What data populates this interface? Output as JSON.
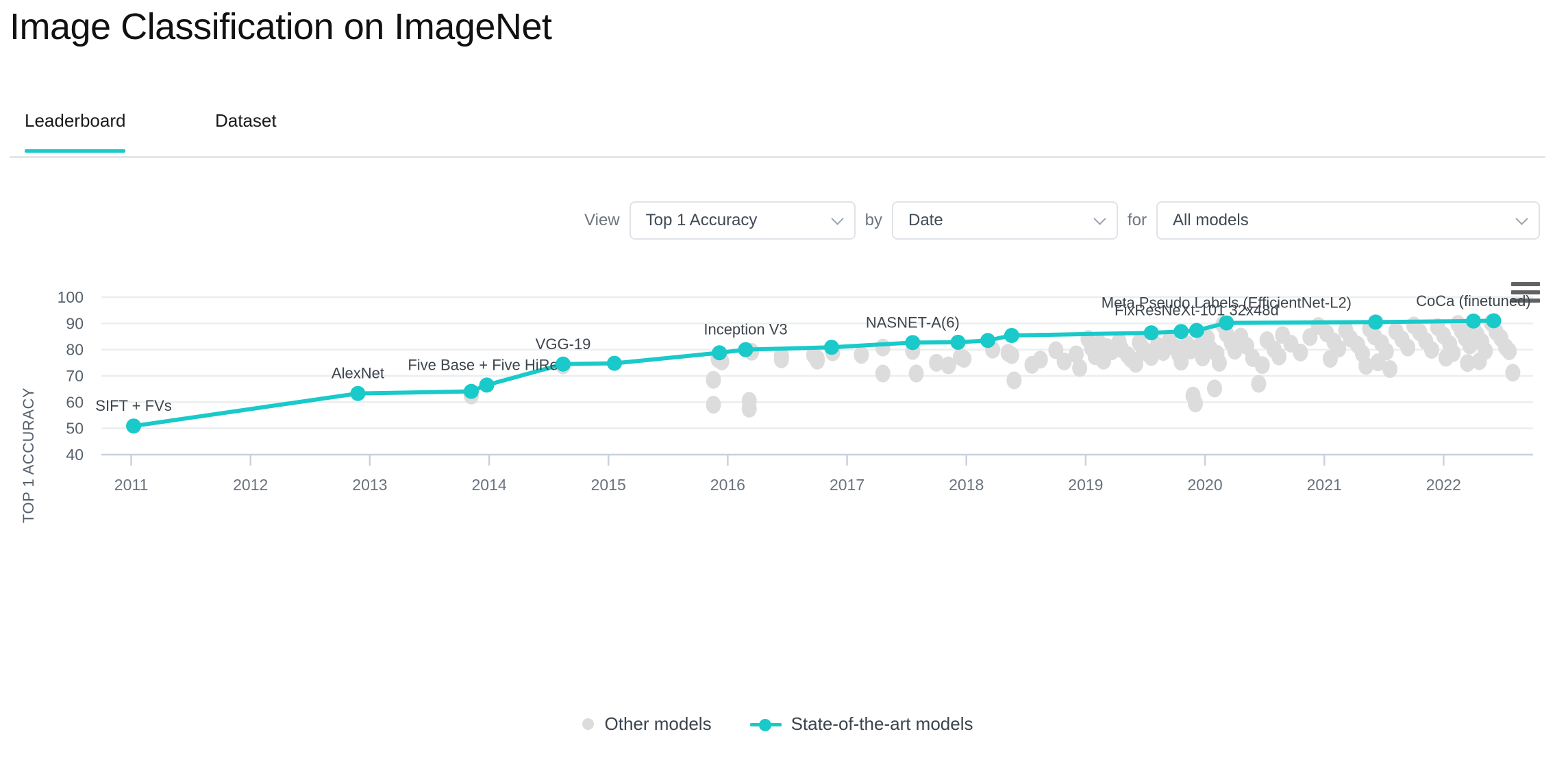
{
  "header": {
    "title": "Image Classification on ImageNet"
  },
  "tabs": [
    {
      "label": "Leaderboard",
      "active": true
    },
    {
      "label": "Dataset",
      "active": false
    }
  ],
  "filters": {
    "view_label": "View",
    "by_label": "by",
    "for_label": "for",
    "metric": "Top 1 Accuracy",
    "axis": "Date",
    "scope": "All models"
  },
  "menu": {
    "icon": "hamburger-menu-icon"
  },
  "legend": {
    "other_models": "Other models",
    "sota_models": "State-of-the-art models"
  },
  "colors": {
    "accent_teal": "#1ac9c9",
    "other_dot_gray": "#dcdcdc",
    "grid": "#ebedee",
    "axis_text": "#55606b"
  },
  "chart_data": {
    "type": "scatter",
    "title": "Image Classification on ImageNet",
    "xlabel": "",
    "ylabel": "TOP 1 ACCURACY",
    "xlim": [
      2010.75,
      2022.75
    ],
    "ylim": [
      40,
      100
    ],
    "yticks": [
      40,
      50,
      60,
      70,
      80,
      90,
      100
    ],
    "xticks": [
      2011,
      2012,
      2013,
      2014,
      2015,
      2016,
      2017,
      2018,
      2019,
      2020,
      2021,
      2022
    ],
    "grid": true,
    "legend_position": "bottom",
    "series": [
      {
        "name": "State-of-the-art models",
        "color": "#1ac9c9",
        "type": "line",
        "points": [
          {
            "x": 2011.02,
            "y": 50.9,
            "label": "SIFT + FVs"
          },
          {
            "x": 2012.9,
            "y": 63.3,
            "label": "AlexNet"
          },
          {
            "x": 2013.85,
            "y": 64.1,
            "label": ""
          },
          {
            "x": 2013.98,
            "y": 66.5,
            "label": "Five Base + Five HiRes"
          },
          {
            "x": 2014.62,
            "y": 74.5,
            "label": "VGG-19"
          },
          {
            "x": 2015.05,
            "y": 74.8,
            "label": ""
          },
          {
            "x": 2015.93,
            "y": 78.8,
            "label": ""
          },
          {
            "x": 2016.15,
            "y": 80.0,
            "label": "Inception V3"
          },
          {
            "x": 2016.87,
            "y": 80.9,
            "label": ""
          },
          {
            "x": 2017.55,
            "y": 82.7,
            "label": "NASNET-A(6)"
          },
          {
            "x": 2017.93,
            "y": 82.8,
            "label": ""
          },
          {
            "x": 2018.18,
            "y": 83.5,
            "label": ""
          },
          {
            "x": 2018.38,
            "y": 85.4,
            "label": ""
          },
          {
            "x": 2019.55,
            "y": 86.4,
            "label": ""
          },
          {
            "x": 2019.8,
            "y": 86.9,
            "label": ""
          },
          {
            "x": 2019.93,
            "y": 87.3,
            "label": "FixResNeXt-101 32x48d"
          },
          {
            "x": 2020.18,
            "y": 90.2,
            "label": "Meta Pseudo Labels (EfficientNet-L2)"
          },
          {
            "x": 2021.43,
            "y": 90.5,
            "label": ""
          },
          {
            "x": 2022.25,
            "y": 90.9,
            "label": "CoCa (finetuned)"
          },
          {
            "x": 2022.42,
            "y": 91.0,
            "label": ""
          }
        ]
      },
      {
        "name": "Other models",
        "color": "#dcdcdc",
        "type": "scatter",
        "points": [
          {
            "x": 2013.85,
            "y": 62.5
          },
          {
            "x": 2014.62,
            "y": 74.0
          },
          {
            "x": 2015.88,
            "y": 68.5
          },
          {
            "x": 2015.88,
            "y": 59.0
          },
          {
            "x": 2016.18,
            "y": 60.5
          },
          {
            "x": 2016.18,
            "y": 57.5
          },
          {
            "x": 2015.92,
            "y": 77.8
          },
          {
            "x": 2015.92,
            "y": 76.4
          },
          {
            "x": 2015.95,
            "y": 75.5
          },
          {
            "x": 2016.2,
            "y": 79.2
          },
          {
            "x": 2016.45,
            "y": 77.5
          },
          {
            "x": 2016.45,
            "y": 76.3
          },
          {
            "x": 2016.72,
            "y": 77.9
          },
          {
            "x": 2016.75,
            "y": 76.6
          },
          {
            "x": 2016.75,
            "y": 75.8
          },
          {
            "x": 2016.88,
            "y": 79.0
          },
          {
            "x": 2017.12,
            "y": 78.0
          },
          {
            "x": 2017.3,
            "y": 80.8
          },
          {
            "x": 2017.3,
            "y": 70.9
          },
          {
            "x": 2017.55,
            "y": 79.5
          },
          {
            "x": 2017.58,
            "y": 70.9
          },
          {
            "x": 2017.95,
            "y": 77.2
          },
          {
            "x": 2017.98,
            "y": 76.5
          },
          {
            "x": 2018.22,
            "y": 80.0
          },
          {
            "x": 2018.35,
            "y": 78.8
          },
          {
            "x": 2018.38,
            "y": 77.9
          },
          {
            "x": 2018.4,
            "y": 68.3
          },
          {
            "x": 2018.62,
            "y": 76.2
          },
          {
            "x": 2018.75,
            "y": 79.8
          },
          {
            "x": 2018.82,
            "y": 75.5
          },
          {
            "x": 2018.92,
            "y": 78.2
          },
          {
            "x": 2019.02,
            "y": 84.1
          },
          {
            "x": 2019.05,
            "y": 80.6
          },
          {
            "x": 2019.12,
            "y": 82.2
          },
          {
            "x": 2019.18,
            "y": 81.0
          },
          {
            "x": 2019.22,
            "y": 79.4
          },
          {
            "x": 2019.28,
            "y": 83.0
          },
          {
            "x": 2019.3,
            "y": 80.2
          },
          {
            "x": 2019.35,
            "y": 78.0
          },
          {
            "x": 2019.38,
            "y": 76.4
          },
          {
            "x": 2019.45,
            "y": 82.7
          },
          {
            "x": 2019.48,
            "y": 80.3
          },
          {
            "x": 2019.52,
            "y": 78.6
          },
          {
            "x": 2019.55,
            "y": 77.2
          },
          {
            "x": 2019.6,
            "y": 81.5
          },
          {
            "x": 2019.65,
            "y": 79.1
          },
          {
            "x": 2019.7,
            "y": 83.4
          },
          {
            "x": 2019.75,
            "y": 80.9
          },
          {
            "x": 2019.78,
            "y": 78.3
          },
          {
            "x": 2019.8,
            "y": 75.4
          },
          {
            "x": 2019.85,
            "y": 82.0
          },
          {
            "x": 2019.88,
            "y": 79.7
          },
          {
            "x": 2019.9,
            "y": 62.5
          },
          {
            "x": 2019.92,
            "y": 59.5
          },
          {
            "x": 2019.95,
            "y": 81.2
          },
          {
            "x": 2019.98,
            "y": 77.0
          },
          {
            "x": 2020.02,
            "y": 84.4
          },
          {
            "x": 2020.05,
            "y": 80.0
          },
          {
            "x": 2020.08,
            "y": 65.2
          },
          {
            "x": 2020.1,
            "y": 78.4
          },
          {
            "x": 2020.15,
            "y": 89.5
          },
          {
            "x": 2020.18,
            "y": 86.0
          },
          {
            "x": 2020.22,
            "y": 82.8
          },
          {
            "x": 2020.25,
            "y": 79.6
          },
          {
            "x": 2020.3,
            "y": 85.0
          },
          {
            "x": 2020.35,
            "y": 81.4
          },
          {
            "x": 2020.4,
            "y": 76.8
          },
          {
            "x": 2020.45,
            "y": 67.0
          },
          {
            "x": 2020.52,
            "y": 83.6
          },
          {
            "x": 2020.58,
            "y": 80.1
          },
          {
            "x": 2020.65,
            "y": 85.6
          },
          {
            "x": 2020.72,
            "y": 82.3
          },
          {
            "x": 2020.8,
            "y": 78.9
          },
          {
            "x": 2020.88,
            "y": 84.8
          },
          {
            "x": 2020.95,
            "y": 89.0
          },
          {
            "x": 2021.02,
            "y": 86.2
          },
          {
            "x": 2021.08,
            "y": 83.1
          },
          {
            "x": 2021.12,
            "y": 80.4
          },
          {
            "x": 2021.18,
            "y": 87.4
          },
          {
            "x": 2021.22,
            "y": 84.2
          },
          {
            "x": 2021.28,
            "y": 81.8
          },
          {
            "x": 2021.32,
            "y": 78.5
          },
          {
            "x": 2021.38,
            "y": 88.0
          },
          {
            "x": 2021.42,
            "y": 85.1
          },
          {
            "x": 2021.48,
            "y": 82.5
          },
          {
            "x": 2021.52,
            "y": 79.3
          },
          {
            "x": 2021.55,
            "y": 72.6
          },
          {
            "x": 2021.6,
            "y": 87.0
          },
          {
            "x": 2021.65,
            "y": 84.0
          },
          {
            "x": 2021.7,
            "y": 80.8
          },
          {
            "x": 2021.75,
            "y": 89.2
          },
          {
            "x": 2021.8,
            "y": 86.6
          },
          {
            "x": 2021.85,
            "y": 83.3
          },
          {
            "x": 2021.9,
            "y": 79.9
          },
          {
            "x": 2021.95,
            "y": 88.6
          },
          {
            "x": 2022.0,
            "y": 85.4
          },
          {
            "x": 2022.05,
            "y": 82.1
          },
          {
            "x": 2022.08,
            "y": 78.7
          },
          {
            "x": 2022.12,
            "y": 89.8
          },
          {
            "x": 2022.15,
            "y": 87.2
          },
          {
            "x": 2022.18,
            "y": 84.6
          },
          {
            "x": 2022.22,
            "y": 81.6
          },
          {
            "x": 2022.25,
            "y": 88.3
          },
          {
            "x": 2022.28,
            "y": 85.8
          },
          {
            "x": 2022.32,
            "y": 83.0
          },
          {
            "x": 2022.35,
            "y": 79.5
          },
          {
            "x": 2022.4,
            "y": 90.2
          },
          {
            "x": 2022.44,
            "y": 86.8
          },
          {
            "x": 2022.48,
            "y": 84.4
          },
          {
            "x": 2022.52,
            "y": 81.0
          },
          {
            "x": 2022.55,
            "y": 79.4
          },
          {
            "x": 2022.58,
            "y": 71.2
          },
          {
            "x": 2019.08,
            "y": 77.5
          },
          {
            "x": 2019.15,
            "y": 75.8
          },
          {
            "x": 2020.12,
            "y": 75.0
          },
          {
            "x": 2020.62,
            "y": 77.4
          },
          {
            "x": 2021.05,
            "y": 76.5
          },
          {
            "x": 2021.45,
            "y": 75.2
          },
          {
            "x": 2022.02,
            "y": 76.9
          },
          {
            "x": 2022.3,
            "y": 75.6
          },
          {
            "x": 2019.42,
            "y": 74.6
          },
          {
            "x": 2020.48,
            "y": 74.1
          },
          {
            "x": 2021.35,
            "y": 73.8
          },
          {
            "x": 2022.2,
            "y": 74.9
          },
          {
            "x": 2018.55,
            "y": 74.2
          },
          {
            "x": 2018.95,
            "y": 73.0
          },
          {
            "x": 2017.75,
            "y": 75.0
          },
          {
            "x": 2017.85,
            "y": 74.0
          }
        ]
      }
    ]
  }
}
